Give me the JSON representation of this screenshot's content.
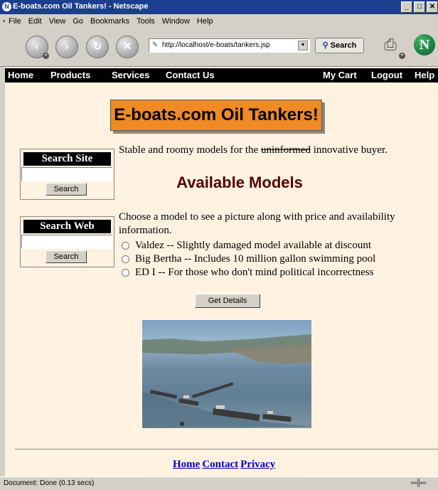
{
  "window": {
    "title": "E-boats.com Oil Tankers! - Netscape",
    "app_icon": "netscape-icon",
    "controls": [
      "_",
      "□",
      "✕"
    ]
  },
  "menu": [
    "File",
    "Edit",
    "View",
    "Go",
    "Bookmarks",
    "Tools",
    "Window",
    "Help"
  ],
  "toolbar": {
    "url": "http://localhost/e-boats/tankers.jsp",
    "search_label": "Search",
    "icons": [
      "back-icon",
      "forward-icon",
      "reload-icon",
      "stop-icon",
      "print-icon",
      "netscape-logo"
    ]
  },
  "site_nav": {
    "left": [
      "Home",
      "Products",
      "Services",
      "Contact Us"
    ],
    "right": [
      "My Cart",
      "Logout",
      "Help"
    ]
  },
  "banner": "E-boats.com Oil Tankers!",
  "sidebar": {
    "search_site": {
      "title": "Search Site",
      "value": "",
      "button": "Search"
    },
    "search_web": {
      "title": "Search Web",
      "value": "",
      "button": "Search"
    }
  },
  "main": {
    "tagline_before": "Stable and roomy models for the",
    "tagline_struck": "uninformed",
    "tagline_after": "innovative buyer.",
    "heading": "Available Models",
    "intro": "Choose a model to see a picture along with price and availability information.",
    "options": [
      {
        "label": "Valdez -- Slightly damaged model available at discount",
        "selected": false
      },
      {
        "label": "Big Bertha -- Includes 10 million gallon swimming pool",
        "selected": false
      },
      {
        "label": "ED I -- For those who don't mind political incorrectness",
        "selected": false
      }
    ],
    "details_button": "Get Details"
  },
  "footer": [
    "Home",
    "Contact",
    "Privacy"
  ],
  "status": "Document: Done (0.13 secs)"
}
